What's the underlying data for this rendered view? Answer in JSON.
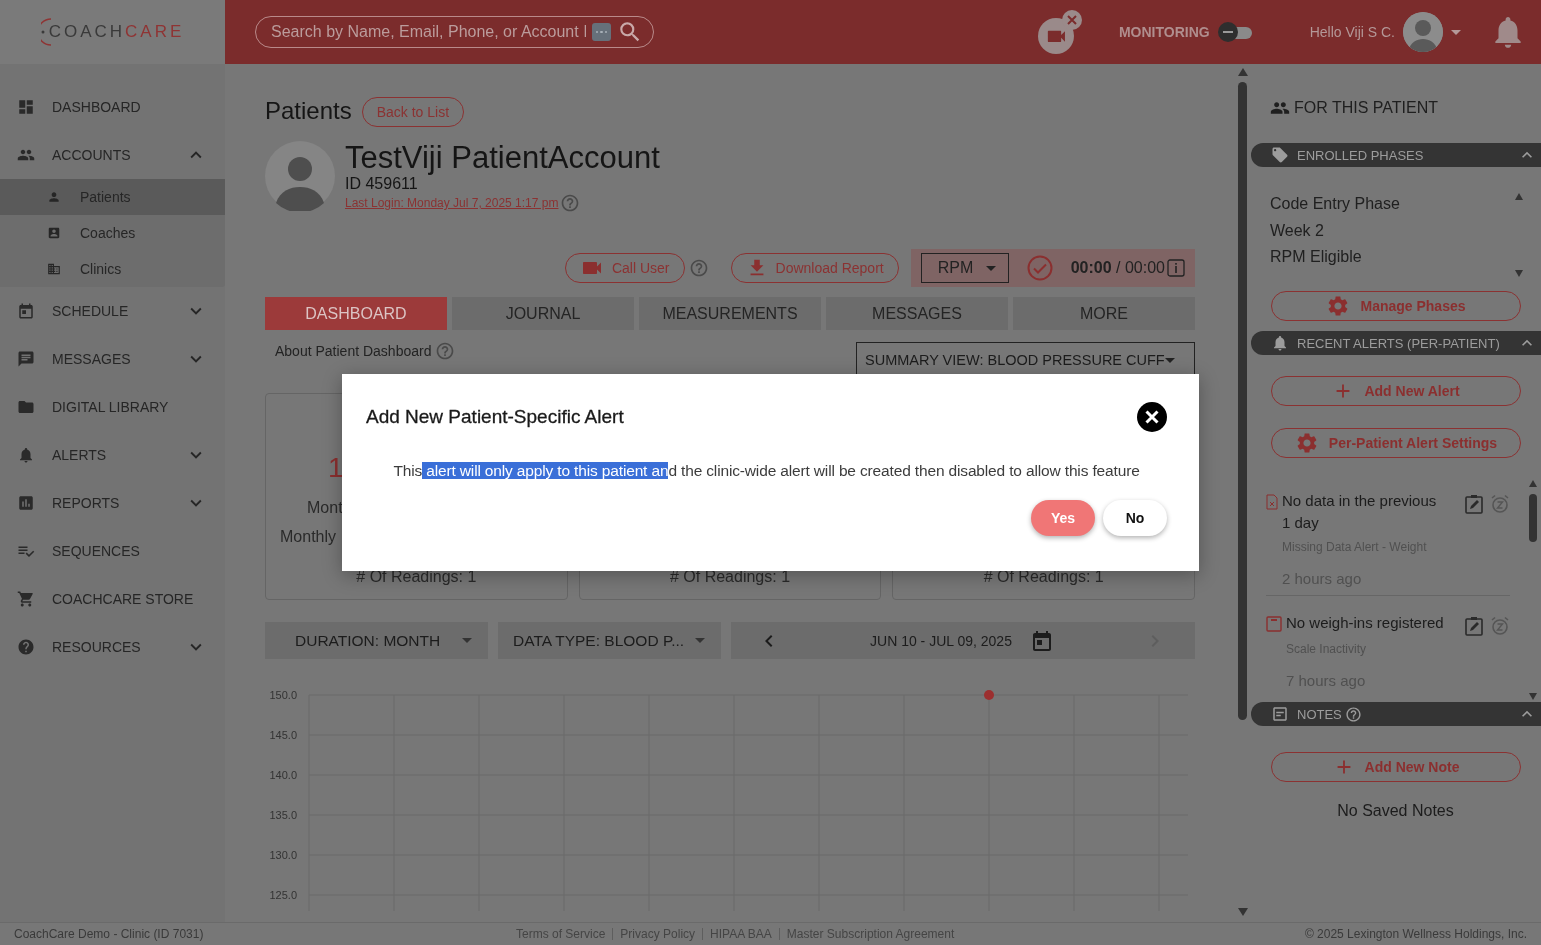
{
  "logo": {
    "dark": "COACH",
    "accent": "CARE"
  },
  "topbar": {
    "search": {
      "placeholder": "Search by Name, Email, Phone, or Account I"
    },
    "monitoring": {
      "label": "MONITORING",
      "on": false
    },
    "greeting": "Hello Viji S C."
  },
  "sidebar": {
    "items": [
      {
        "label": "DASHBOARD",
        "selected": false
      },
      {
        "label": "ACCOUNTS",
        "selected": false,
        "expanded": true,
        "children": [
          {
            "label": "Patients",
            "selected": true
          },
          {
            "label": "Coaches",
            "selected": false
          },
          {
            "label": "Clinics",
            "selected": false
          }
        ]
      },
      {
        "label": "SCHEDULE",
        "selected": false,
        "expanded": false
      },
      {
        "label": "MESSAGES",
        "selected": false,
        "expanded": false
      },
      {
        "label": "DIGITAL LIBRARY",
        "selected": false
      },
      {
        "label": "ALERTS",
        "selected": false,
        "expanded": false
      },
      {
        "label": "REPORTS",
        "selected": false,
        "expanded": false
      },
      {
        "label": "SEQUENCES",
        "selected": false
      },
      {
        "label": "COACHCARE STORE",
        "selected": false
      },
      {
        "label": "RESOURCES",
        "selected": false,
        "expanded": false
      }
    ]
  },
  "page": {
    "title": "Patients",
    "back_button": "Back to List",
    "patient": {
      "name": "TestViji PatientAccount",
      "id": "ID 459611",
      "last_login": "Last Login: Monday Jul 7, 2025 1:17 pm"
    },
    "actions": {
      "call": "Call User",
      "download": "Download Report",
      "program": "RPM",
      "timer": "**00:00** / 00:00"
    },
    "tabs": [
      {
        "label": "DASHBOARD",
        "selected": true
      },
      {
        "label": "JOURNAL",
        "selected": false
      },
      {
        "label": "MEASUREMENTS",
        "selected": false
      },
      {
        "label": "MESSAGES",
        "selected": false
      },
      {
        "label": "MORE",
        "selected": false
      }
    ],
    "about": "About Patient Dashboard",
    "summary_view": "SUMMARY VIEW:  BLOOD PRESSURE CUFF",
    "cards": [
      {
        "value": "1",
        "label": "Mont",
        "sublabel": "Monthly",
        "readings": "# Of Readings: 1"
      },
      {
        "readings": "# Of Readings: 1"
      },
      {
        "readings": "# Of Readings: 1"
      }
    ],
    "filters": {
      "duration": "DURATION: MONTH",
      "data_type": "DATA TYPE: BLOOD P...",
      "date_range": "JUN 10 - JUL 09, 2025"
    },
    "chart_data": {
      "type": "scatter",
      "categories": [
        null,
        null,
        null,
        null,
        null,
        null,
        null,
        null,
        null,
        null,
        null
      ],
      "ylim": [
        123,
        150
      ],
      "grid": true,
      "yticks": [
        {
          "value": 125,
          "label": "125.0"
        },
        {
          "value": 130,
          "label": "130.0"
        },
        {
          "value": 135,
          "label": "135.0"
        },
        {
          "value": 140,
          "label": "140.0"
        },
        {
          "value": 145,
          "label": "145.0"
        },
        {
          "value": 150,
          "label": "150.0"
        }
      ],
      "series": [
        {
          "color": "#9c2f2f",
          "values": [
            null,
            null,
            null,
            null,
            null,
            null,
            null,
            null,
            150,
            null,
            null
          ]
        }
      ]
    }
  },
  "right_panel": {
    "title": "FOR THIS PATIENT",
    "sections": [
      {
        "kind": "phases",
        "title": "ENROLLED PHASES",
        "expanded": true,
        "items": [
          "Code Entry Phase",
          "Week 2",
          "RPM Eligible"
        ],
        "buttons": [
          {
            "kind": "settings",
            "label": "Manage Phases"
          }
        ]
      },
      {
        "kind": "alerts",
        "title": "RECENT ALERTS (PER-PATIENT)",
        "expanded": true,
        "buttons": [
          {
            "kind": "add",
            "label": "Add New Alert"
          },
          {
            "kind": "settings",
            "label": "Per-Patient Alert Settings"
          }
        ],
        "alerts": [
          {
            "kind": "missing_data",
            "title": "No data in the previous 1 day",
            "type": "Missing Data Alert - Weight",
            "time": "2 hours ago"
          },
          {
            "kind": "inactivity",
            "title": "No weigh-ins registered",
            "type": "Scale Inactivity",
            "time": "7 hours ago"
          }
        ]
      },
      {
        "kind": "notes",
        "title": "NOTES",
        "expanded": true,
        "buttons": [
          {
            "kind": "add",
            "label": "Add New Note"
          }
        ],
        "empty": "No Saved Notes"
      }
    ]
  },
  "dialog": {
    "title": "Add New Patient-Specific Alert",
    "message": [
      {
        "text": "This",
        "selected": false
      },
      {
        "text": " alert will only apply to this patient an",
        "selected": true
      },
      {
        "text": "d the clinic-wide alert will be created then disabled to allow this feature",
        "selected": false
      }
    ],
    "buttons": [
      {
        "kind": "primary",
        "label": "Yes"
      },
      {
        "kind": "secondary",
        "label": "No"
      }
    ]
  },
  "footer": {
    "clinic": "CoachCare Demo - Clinic (ID 7031)",
    "links": [
      "Terms of Service",
      "Privacy Policy",
      "HIPAA BAA",
      "Master Subscription Agreement"
    ],
    "copyright": "© 2025 Lexington Wellness Holdings, Inc."
  }
}
